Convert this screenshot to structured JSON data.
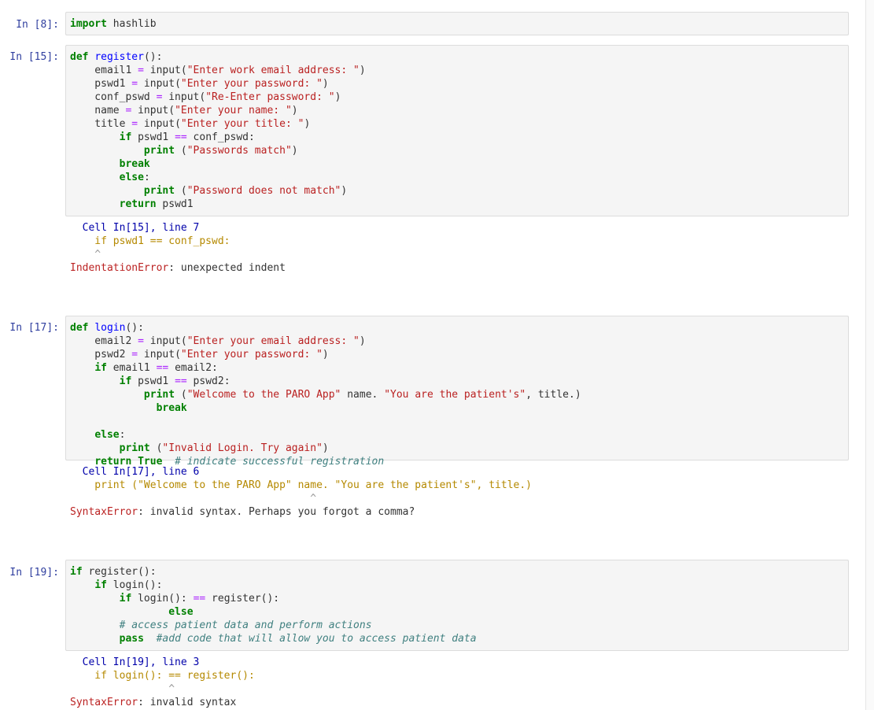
{
  "cells": [
    {
      "prompt": "In [8]:",
      "code": [
        [
          [
            "kw",
            "import"
          ],
          [
            "t",
            " hashlib"
          ]
        ]
      ],
      "output": []
    },
    {
      "prompt": "In [15]:",
      "code": [
        [
          [
            "kw",
            "def"
          ],
          [
            "t",
            " "
          ],
          [
            "fn",
            "register"
          ],
          [
            "t",
            "():"
          ]
        ],
        [
          [
            "t",
            "    email1 "
          ],
          [
            "op",
            "="
          ],
          [
            "t",
            " input("
          ],
          [
            "str",
            "\"Enter work email address: \""
          ],
          [
            "t",
            ")"
          ]
        ],
        [
          [
            "t",
            "    pswd1 "
          ],
          [
            "op",
            "="
          ],
          [
            "t",
            " input("
          ],
          [
            "str",
            "\"Enter your password: \""
          ],
          [
            "t",
            ")"
          ]
        ],
        [
          [
            "t",
            "    conf_pswd "
          ],
          [
            "op",
            "="
          ],
          [
            "t",
            " input("
          ],
          [
            "str",
            "\"Re-Enter password: \""
          ],
          [
            "t",
            ")"
          ]
        ],
        [
          [
            "t",
            "    name "
          ],
          [
            "op",
            "="
          ],
          [
            "t",
            " input("
          ],
          [
            "str",
            "\"Enter your name: \""
          ],
          [
            "t",
            ")"
          ]
        ],
        [
          [
            "t",
            "    title "
          ],
          [
            "op",
            "="
          ],
          [
            "t",
            " input("
          ],
          [
            "str",
            "\"Enter your title: \""
          ],
          [
            "t",
            ")"
          ]
        ],
        [
          [
            "t",
            "        "
          ],
          [
            "kw",
            "if"
          ],
          [
            "t",
            " pswd1 "
          ],
          [
            "op",
            "=="
          ],
          [
            "t",
            " conf_pswd:"
          ]
        ],
        [
          [
            "t",
            "            "
          ],
          [
            "kw",
            "print"
          ],
          [
            "t",
            " ("
          ],
          [
            "str",
            "\"Passwords match\""
          ],
          [
            "t",
            ")"
          ]
        ],
        [
          [
            "t",
            "        "
          ],
          [
            "kw",
            "break"
          ]
        ],
        [
          [
            "t",
            "        "
          ],
          [
            "kw",
            "else"
          ],
          [
            "t",
            ":"
          ]
        ],
        [
          [
            "t",
            "            "
          ],
          [
            "kw",
            "print"
          ],
          [
            "t",
            " ("
          ],
          [
            "str",
            "\"Password does not match\""
          ],
          [
            "t",
            ")"
          ]
        ],
        [
          [
            "t",
            "        "
          ],
          [
            "kw",
            "return"
          ],
          [
            "t",
            " pswd1"
          ]
        ]
      ],
      "output": [
        [
          [
            "tbh",
            "  Cell In[15], line 7"
          ]
        ],
        [
          [
            "src",
            "    if pswd1 == conf_pswd:"
          ]
        ],
        [
          [
            "caret",
            "    ^"
          ]
        ],
        [
          [
            "err",
            "IndentationError"
          ],
          [
            "t",
            ": unexpected indent"
          ]
        ]
      ]
    },
    {
      "prompt": "In [17]:",
      "code": [
        [
          [
            "kw",
            "def"
          ],
          [
            "t",
            " "
          ],
          [
            "fn",
            "login"
          ],
          [
            "t",
            "():"
          ]
        ],
        [
          [
            "t",
            "    email2 "
          ],
          [
            "op",
            "="
          ],
          [
            "t",
            " input("
          ],
          [
            "str",
            "\"Enter your email address: \""
          ],
          [
            "t",
            ")"
          ]
        ],
        [
          [
            "t",
            "    pswd2 "
          ],
          [
            "op",
            "="
          ],
          [
            "t",
            " input("
          ],
          [
            "str",
            "\"Enter your password: \""
          ],
          [
            "t",
            ")"
          ]
        ],
        [
          [
            "t",
            "    "
          ],
          [
            "kw",
            "if"
          ],
          [
            "t",
            " email1 "
          ],
          [
            "op",
            "=="
          ],
          [
            "t",
            " email2:"
          ]
        ],
        [
          [
            "t",
            "        "
          ],
          [
            "kw",
            "if"
          ],
          [
            "t",
            " pswd1 "
          ],
          [
            "op",
            "=="
          ],
          [
            "t",
            " pswd2:"
          ]
        ],
        [
          [
            "t",
            "            "
          ],
          [
            "kw",
            "print"
          ],
          [
            "t",
            " ("
          ],
          [
            "str",
            "\"Welcome to the PARO App\""
          ],
          [
            "t",
            " name. "
          ],
          [
            "str",
            "\"You are the patient's\""
          ],
          [
            "t",
            ", title.)"
          ]
        ],
        [
          [
            "t",
            "              "
          ],
          [
            "kw",
            "break"
          ]
        ],
        [
          [
            "t",
            ""
          ]
        ],
        [
          [
            "t",
            "    "
          ],
          [
            "kw",
            "else"
          ],
          [
            "t",
            ":"
          ]
        ],
        [
          [
            "t",
            "        "
          ],
          [
            "kw",
            "print"
          ],
          [
            "t",
            " ("
          ],
          [
            "str",
            "\"Invalid Login. Try again\""
          ],
          [
            "t",
            ")"
          ]
        ],
        [
          [
            "t",
            "    "
          ],
          [
            "kw",
            "return"
          ],
          [
            "t",
            " "
          ],
          [
            "kw",
            "True"
          ],
          [
            "t",
            "  "
          ],
          [
            "cm",
            "# indicate successful registration"
          ]
        ]
      ],
      "output": [
        [
          [
            "tbh",
            "  Cell In[17], line 6"
          ]
        ],
        [
          [
            "src",
            "    print (\"Welcome to the PARO App\" name. \"You are the patient's\", title.)"
          ]
        ],
        [
          [
            "caret",
            "                                       ^"
          ]
        ],
        [
          [
            "err",
            "SyntaxError"
          ],
          [
            "t",
            ": invalid syntax. Perhaps you forgot a comma?"
          ]
        ]
      ]
    },
    {
      "prompt": "In [19]:",
      "code": [
        [
          [
            "kw",
            "if"
          ],
          [
            "t",
            " register():"
          ]
        ],
        [
          [
            "t",
            "    "
          ],
          [
            "kw",
            "if"
          ],
          [
            "t",
            " login():"
          ]
        ],
        [
          [
            "t",
            "        "
          ],
          [
            "kw",
            "if"
          ],
          [
            "t",
            " login(): "
          ],
          [
            "op",
            "=="
          ],
          [
            "t",
            " register():"
          ]
        ],
        [
          [
            "t",
            "                "
          ],
          [
            "kw",
            "else"
          ]
        ],
        [
          [
            "t",
            "        "
          ],
          [
            "cm",
            "# access patient data and perform actions"
          ]
        ],
        [
          [
            "t",
            "        "
          ],
          [
            "kw",
            "pass"
          ],
          [
            "t",
            "  "
          ],
          [
            "cm",
            "#add code that will allow you to access patient data"
          ]
        ]
      ],
      "output": [
        [
          [
            "tbh",
            "  Cell In[19], line 3"
          ]
        ],
        [
          [
            "src",
            "    if login(): == register():"
          ]
        ],
        [
          [
            "caret",
            "                ^"
          ]
        ],
        [
          [
            "err",
            "SyntaxError"
          ],
          [
            "t",
            ": invalid syntax"
          ]
        ]
      ]
    }
  ]
}
